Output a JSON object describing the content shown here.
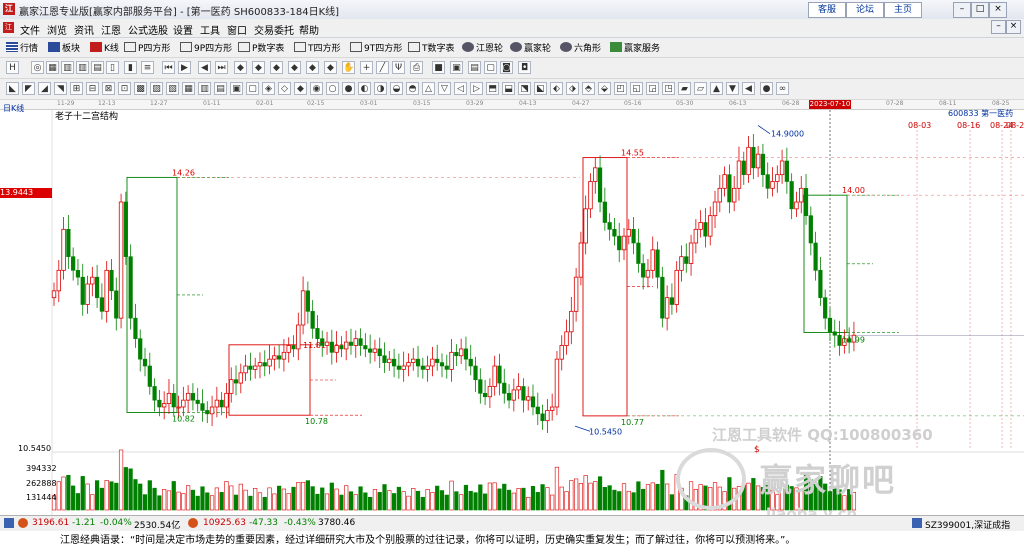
{
  "window": {
    "title": "赢家江恩专业版[赢家内部服务平台] - [第一医药  SH600833-184日K线]",
    "links": [
      "客服",
      "论坛",
      "主页"
    ]
  },
  "menu": [
    "文件",
    "浏览",
    "资讯",
    "江恩",
    "公式选股",
    "设置",
    "工具",
    "窗口",
    "交易委托",
    "帮助"
  ],
  "toolbar1": [
    "行情",
    "板块",
    "K线",
    "P四方形",
    "9P四方形",
    "P数字表",
    "T四方形",
    "9T四方形",
    "T数字表",
    "江恩轮",
    "赢家轮",
    "六角形",
    "赢家服务"
  ],
  "date_axis": [
    "11-29",
    "12-13",
    "12-27",
    "01-11",
    "02-01",
    "02-15",
    "03-01",
    "03-15",
    "03-29",
    "04-13",
    "04-27",
    "05-16",
    "05-30",
    "06-13",
    "06-28",
    "07-28",
    "08-11",
    "08-25"
  ],
  "cursor_date": "2023-07-10",
  "period_label": "日K线",
  "study_name": "老子十二宫结构",
  "symbol_label": "600833  第一医药",
  "last_price": "13.9443",
  "price_labels": {
    "b1_high": "14.26",
    "b1_low": "10.82",
    "b2_high": "11.81",
    "b2_low": "10.78",
    "b3_high": "14.55",
    "b3_low": "10.77",
    "b4_high": "14.00",
    "b4_low": "11.99",
    "peak": "14.9000",
    "trough": "10.5450",
    "axis_low": "10.5450"
  },
  "future_dates": [
    "08-03",
    "08-16",
    "08-24",
    "08-29"
  ],
  "dollar_mark": "$",
  "volume_labels": [
    "394332",
    "262888",
    "131444"
  ],
  "watermark": {
    "line1": "江恩工具软件  QQ:100800360",
    "brand": "赢家聊吧",
    "url": "liaoba.v.cn"
  },
  "status": {
    "sh_index": "3196.61",
    "sh_change": "-1.21",
    "sh_pct": "-0.04%",
    "sh_amount": "2530.54亿",
    "sz_index": "10925.63",
    "sz_change": "-47.33",
    "sz_pct": "-0.43%",
    "sz_amount": "3780.46",
    "right_code": "SZ399001,深证成指"
  },
  "quote": "江恩经典语录：“时间是决定市场走势的重要因素，经过详细研究大市及个别股票的过往记录，你将可以证明，历史确实重复发生；而了解过往，你将可以预测将来。”。",
  "colors": {
    "up": "#dd0000",
    "down": "#008000",
    "accent": "#0030a0"
  },
  "chart_data": {
    "type": "candlestick",
    "symbol": "600833",
    "y_range": [
      10.3,
      15.1
    ],
    "volume_ticks": [
      394332,
      262888,
      131444
    ],
    "closes": [
      12.6,
      12.9,
      13.5,
      13.1,
      12.9,
      12.8,
      12.4,
      12.7,
      12.8,
      12.5,
      12.3,
      12.9,
      12.6,
      12.2,
      13.9,
      13.1,
      12.2,
      11.9,
      11.6,
      11.5,
      11.2,
      11.0,
      10.9,
      10.95,
      11.1,
      10.9,
      10.9,
      11.0,
      11.1,
      11.0,
      10.95,
      10.85,
      10.8,
      10.9,
      11.0,
      10.9,
      11.1,
      11.3,
      11.25,
      11.4,
      11.5,
      11.45,
      11.5,
      11.55,
      11.5,
      11.6,
      11.65,
      11.6,
      11.7,
      11.8,
      11.75,
      12.1,
      12.6,
      12.3,
      12.05,
      11.9,
      11.8,
      11.85,
      11.7,
      11.8,
      11.75,
      11.85,
      11.8,
      11.9,
      11.8,
      11.75,
      11.7,
      11.75,
      11.65,
      11.55,
      11.6,
      11.5,
      11.45,
      11.5,
      11.55,
      11.6,
      11.5,
      11.45,
      11.5,
      11.6,
      11.55,
      11.5,
      11.45,
      11.7,
      11.65,
      11.75,
      11.6,
      11.5,
      11.3,
      11.1,
      11.05,
      11.2,
      11.5,
      11.25,
      11.1,
      11.0,
      11.15,
      11.2,
      11.0,
      11.05,
      10.9,
      10.8,
      10.7,
      10.85,
      10.9,
      11.6,
      11.8,
      12.0,
      12.3,
      12.8,
      13.3,
      13.8,
      14.2,
      14.4,
      13.9,
      13.6,
      13.5,
      13.4,
      13.2,
      13.4,
      13.5,
      13.3,
      13.0,
      12.8,
      12.9,
      13.2,
      12.8,
      12.2,
      12.5,
      12.4,
      12.9,
      13.1,
      13.0,
      13.3,
      13.5,
      13.6,
      13.4,
      13.7,
      13.9,
      14.1,
      14.3,
      13.9,
      14.1,
      14.5,
      14.3,
      14.7,
      14.4,
      14.6,
      14.3,
      14.1,
      14.2,
      14.3,
      14.5,
      14.2,
      13.8,
      13.9,
      14.1,
      13.7,
      13.3,
      12.9,
      12.5,
      12.2,
      12.0,
      11.95,
      11.8,
      11.9,
      11.85,
      11.95
    ]
  }
}
